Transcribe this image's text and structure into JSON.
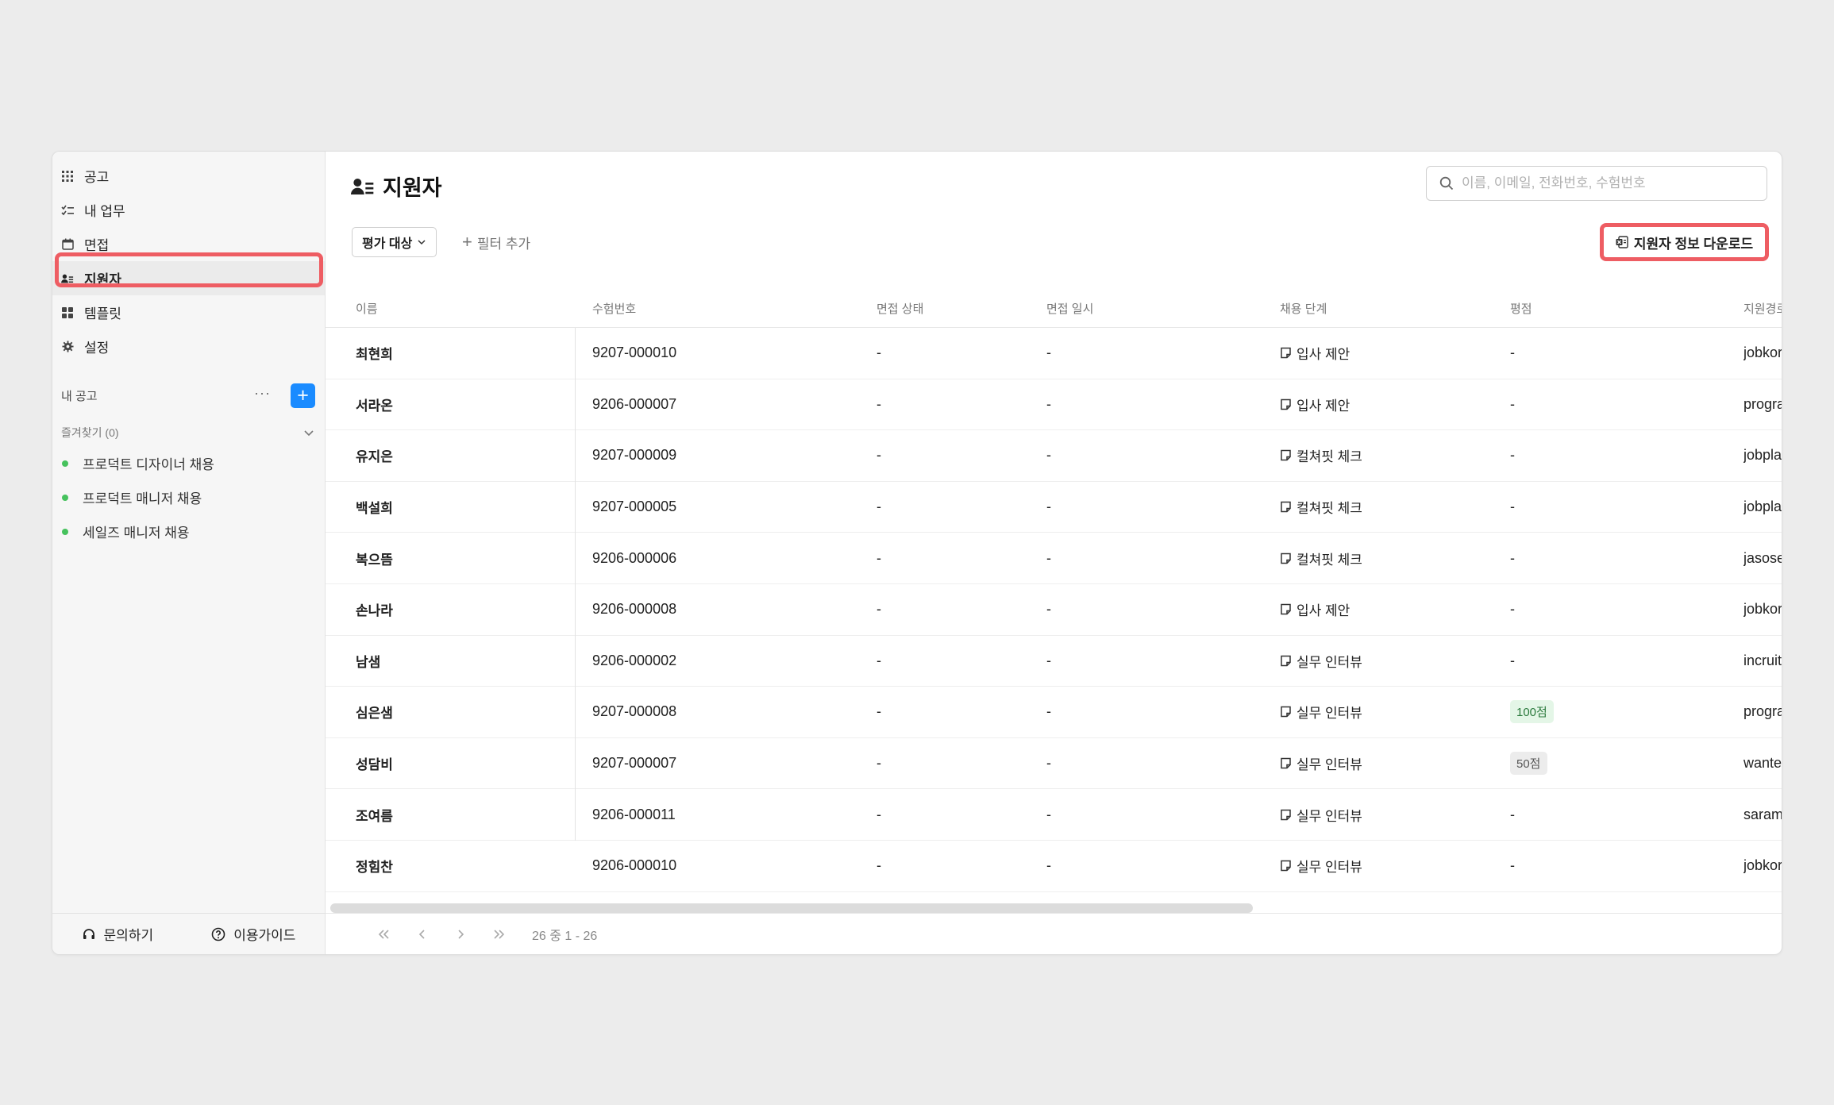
{
  "sidebar": {
    "nav": [
      {
        "label": "공고",
        "icon": "grid-icon"
      },
      {
        "label": "내 업무",
        "icon": "checklist-icon"
      },
      {
        "label": "면접",
        "icon": "calendar-icon"
      },
      {
        "label": "지원자",
        "icon": "applicants-icon",
        "active": true
      },
      {
        "label": "템플릿",
        "icon": "template-icon"
      },
      {
        "label": "설정",
        "icon": "gear-icon"
      }
    ],
    "my_jobs_label": "내 공고",
    "more_label": "···",
    "add_label": "+",
    "favorites_label": "즐겨찾기 (0)",
    "jobs": [
      "프로덕트 디자이너 채용",
      "프로덕트 매니저 채용",
      "세일즈 매니저 채용"
    ],
    "footer": {
      "contact": "문의하기",
      "guide": "이용가이드"
    }
  },
  "header": {
    "title": "지원자",
    "search_placeholder": "이름, 이메일, 전화번호, 수험번호"
  },
  "toolbar": {
    "filter_label": "평가 대상",
    "add_filter_label": "필터 추가",
    "download_label": "지원자 정보 다운로드"
  },
  "table": {
    "columns": [
      "이름",
      "수험번호",
      "면접 상태",
      "면접 일시",
      "채용 단계",
      "평점",
      "지원경로"
    ],
    "rows": [
      {
        "name": "최현희",
        "num": "9207-000010",
        "ist": "-",
        "idt": "-",
        "stage": "입사 제안",
        "score": "-",
        "src": "jobkorea.co.kr"
      },
      {
        "name": "서라온",
        "num": "9206-000007",
        "ist": "-",
        "idt": "-",
        "stage": "입사 제안",
        "score": "-",
        "src": "programmers"
      },
      {
        "name": "유지은",
        "num": "9207-000009",
        "ist": "-",
        "idt": "-",
        "stage": "컬쳐핏 체크",
        "score": "-",
        "src": "jobplanet.co.kr"
      },
      {
        "name": "백설희",
        "num": "9207-000005",
        "ist": "-",
        "idt": "-",
        "stage": "컬쳐핏 체크",
        "score": "-",
        "src": "jobplanet.co.kr"
      },
      {
        "name": "복으뜸",
        "num": "9206-000006",
        "ist": "-",
        "idt": "-",
        "stage": "컬쳐핏 체크",
        "score": "-",
        "src": "jasoseol.com"
      },
      {
        "name": "손나라",
        "num": "9206-000008",
        "ist": "-",
        "idt": "-",
        "stage": "입사 제안",
        "score": "-",
        "src": "jobkorea.co.kr"
      },
      {
        "name": "남샘",
        "num": "9206-000002",
        "ist": "-",
        "idt": "-",
        "stage": "실무 인터뷰",
        "score": "-",
        "src": "incruit.com"
      },
      {
        "name": "심은샘",
        "num": "9207-000008",
        "ist": "-",
        "idt": "-",
        "stage": "실무 인터뷰",
        "score": "100점",
        "score_style": "green",
        "src": "programmers"
      },
      {
        "name": "성담비",
        "num": "9207-000007",
        "ist": "-",
        "idt": "-",
        "stage": "실무 인터뷰",
        "score": "50점",
        "score_style": "gray",
        "src": "wanted.co.kr"
      },
      {
        "name": "조여름",
        "num": "9206-000011",
        "ist": "-",
        "idt": "-",
        "stage": "실무 인터뷰",
        "score": "-",
        "src": "saramin.co.kr"
      },
      {
        "name": "정힘찬",
        "num": "9206-000010",
        "ist": "-",
        "idt": "-",
        "stage": "실무 인터뷰",
        "score": "-",
        "src": "jobkorea.co.kr"
      }
    ]
  },
  "pagination": {
    "summary": "26 중 1 - 26"
  },
  "colors": {
    "accent": "#1a8bff",
    "highlight": "#ee5d63",
    "dot": "#46c25d"
  }
}
